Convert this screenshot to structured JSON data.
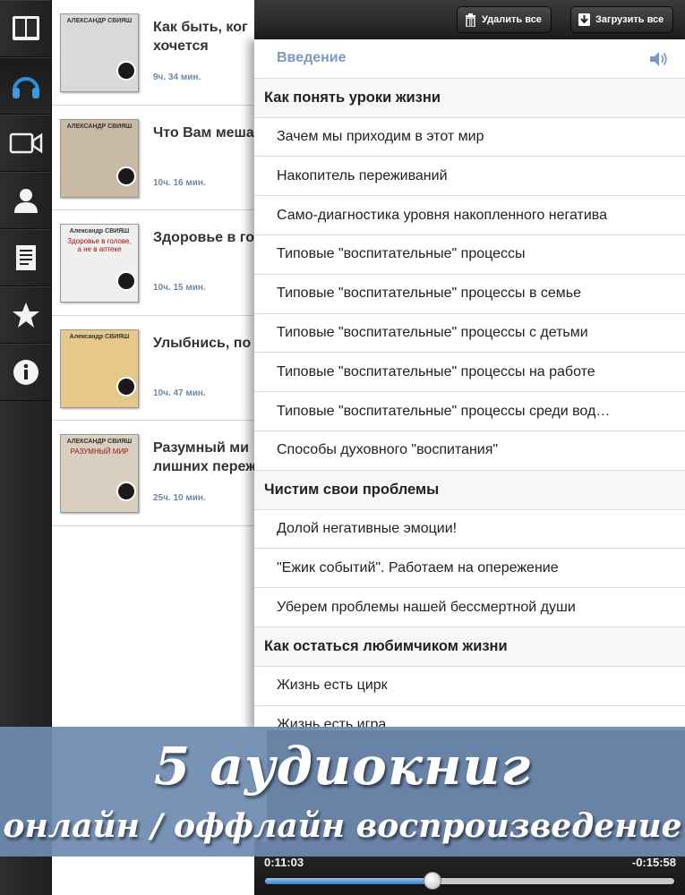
{
  "sidebar": {
    "items": [
      {
        "icon": "book-icon",
        "selected": false
      },
      {
        "icon": "headphones-icon",
        "selected": true
      },
      {
        "icon": "video-camera-icon",
        "selected": false
      },
      {
        "icon": "person-icon",
        "selected": false
      },
      {
        "icon": "document-icon",
        "selected": false
      },
      {
        "icon": "star-icon",
        "selected": false
      },
      {
        "icon": "info-icon",
        "selected": false
      }
    ]
  },
  "books": [
    {
      "title": "Как быть, ког\nхочется",
      "duration": "9ч. 34 мин.",
      "cover_author": "АЛЕКСАНДР СВИЯШ",
      "cover_title": "",
      "cover_color": "#d9d9d9"
    },
    {
      "title": "Что Вам меша",
      "duration": "10ч. 16 мин.",
      "cover_author": "АЛЕКСАНДР СВИЯШ",
      "cover_title": "",
      "cover_color": "#c8b9a5"
    },
    {
      "title": "Здоровье в го",
      "duration": "10ч. 15 мин.",
      "cover_author": "Александр СВИЯШ",
      "cover_title": "Здоровье в голове, а не в аптеке",
      "cover_color": "#efefef"
    },
    {
      "title": "Улыбнись, по",
      "duration": "10ч. 47 мин.",
      "cover_author": "Александр СВИЯШ",
      "cover_title": "",
      "cover_color": "#e8c78a"
    },
    {
      "title": "Разумный ми\nлишних переж",
      "duration": "25ч. 10 мин.",
      "cover_author": "АЛЕКСАНДР СВИЯШ",
      "cover_title": "РАЗУМНЫЙ МИР",
      "cover_color": "#d8cfc0"
    }
  ],
  "toolbar": {
    "delete_all": "Удалить все",
    "download_all": "Загрузить все"
  },
  "chapters": [
    {
      "kind": "intro",
      "text": "Введение"
    },
    {
      "kind": "section",
      "text": "Как понять уроки жизни"
    },
    {
      "kind": "item",
      "text": "Зачем мы приходим в этот мир"
    },
    {
      "kind": "item",
      "text": "Накопитель переживаний"
    },
    {
      "kind": "item",
      "text": "Само-диагностика уровня накопленного негатива"
    },
    {
      "kind": "item",
      "text": "Типовые \"воспитательные\" процессы"
    },
    {
      "kind": "item",
      "text": "Типовые \"воспитательные\" процессы в семье"
    },
    {
      "kind": "item",
      "text": "Типовые \"воспитательные\" процессы с детьми"
    },
    {
      "kind": "item",
      "text": "Типовые \"воспитательные\" процессы на работе"
    },
    {
      "kind": "item",
      "text": "Типовые \"воспитательные\" процессы среди вод…"
    },
    {
      "kind": "item",
      "text": "Способы духовного \"воспитания\""
    },
    {
      "kind": "section",
      "text": "Чистим свои проблемы"
    },
    {
      "kind": "item",
      "text": "Долой негативные эмоции!"
    },
    {
      "kind": "item",
      "text": "\"Ежик событий\". Работаем на опережение"
    },
    {
      "kind": "item",
      "text": "Уберем проблемы нашей бессмертной души"
    },
    {
      "kind": "section",
      "text": "Как остаться любимчиком жизни"
    },
    {
      "kind": "item",
      "text": "Жизнь есть цирк"
    },
    {
      "kind": "item",
      "text": "Жизнь есть игра"
    }
  ],
  "player": {
    "elapsed": "0:11:03",
    "remaining": "-0:15:58",
    "progress": 0.41
  },
  "banner": {
    "line1": "5 аудиокниг",
    "line2": "онлайн / оффлайн воспроизведение"
  },
  "colors": {
    "accent": "#6d87a6",
    "intro": "#7d99bf",
    "banner": "#6f8bb2"
  }
}
